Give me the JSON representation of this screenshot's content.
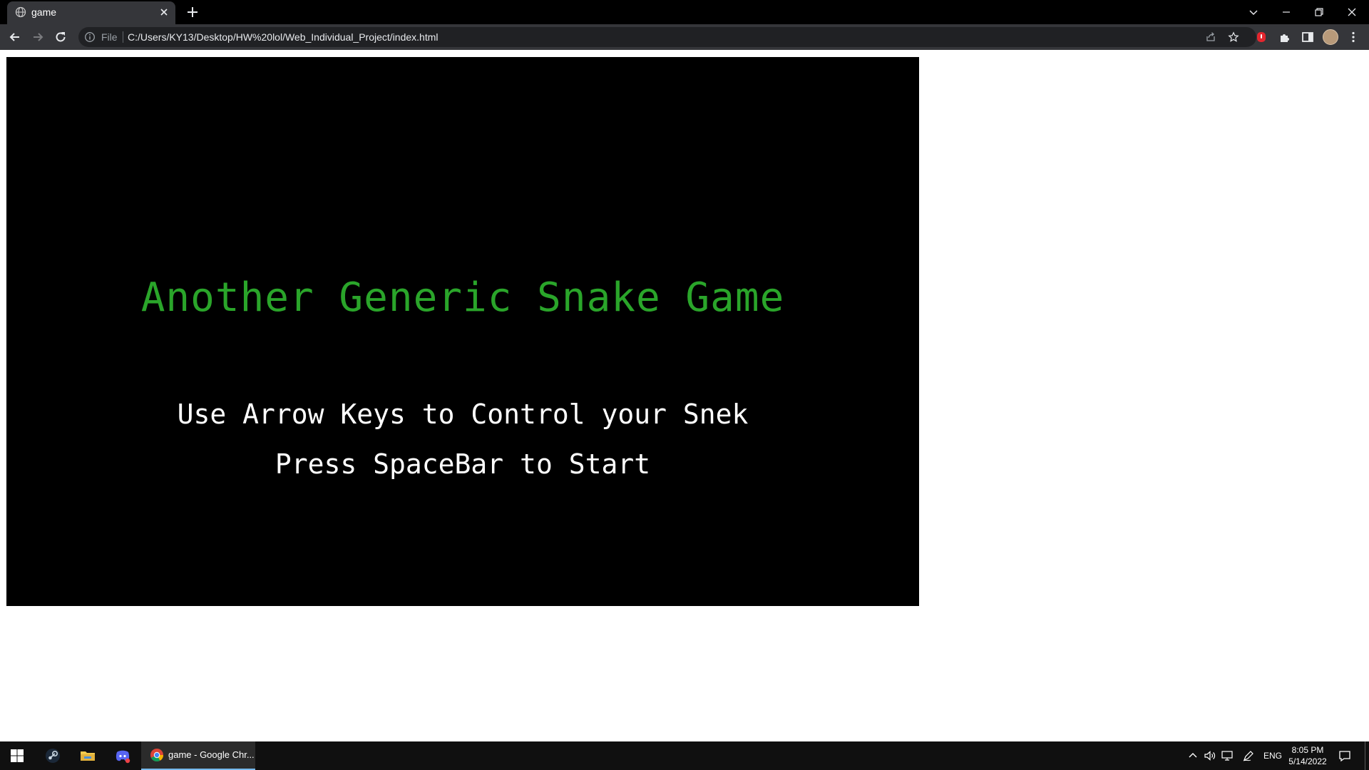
{
  "browser": {
    "tab": {
      "title": "game",
      "favicon": "globe-icon"
    },
    "address_bar": {
      "scheme": "File",
      "url": "C:/Users/KY13/Desktop/HW%20lol/Web_Individual_Project/index.html"
    }
  },
  "game": {
    "title": "Another Generic Snake Game",
    "instruction_1": "Use Arrow Keys to Control your Snek",
    "instruction_2": "Press SpaceBar to Start",
    "colors": {
      "title": "#2aa52a",
      "text": "#ffffff",
      "background": "#000000"
    }
  },
  "taskbar": {
    "pinned": [
      "windows-start-icon",
      "steam-icon",
      "file-explorer-icon",
      "discord-icon"
    ],
    "active_app": {
      "label": "game - Google Chr...",
      "icon": "chrome-icon"
    },
    "tray": {
      "language": "ENG",
      "time": "8:05 PM",
      "date": "5/14/2022"
    }
  }
}
